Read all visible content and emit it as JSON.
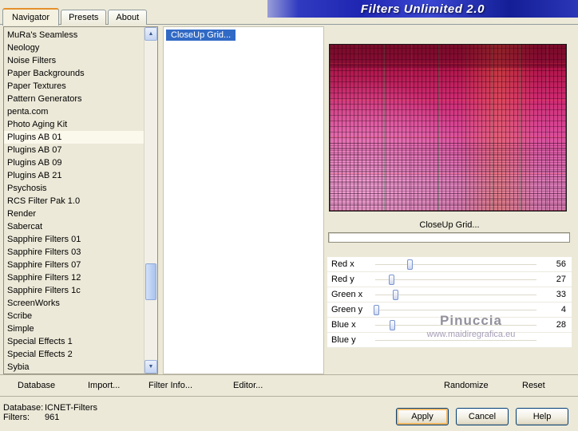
{
  "title": "Filters Unlimited 2.0",
  "tabs": [
    {
      "label": "Navigator"
    },
    {
      "label": "Presets"
    },
    {
      "label": "About"
    }
  ],
  "icons": {
    "scroll_up": "▲",
    "scroll_down": "▼"
  },
  "navigator": {
    "items": [
      "MuRa's Seamless",
      "Neology",
      "Noise Filters",
      "Paper Backgrounds",
      "Paper Textures",
      "Pattern Generators",
      "penta.com",
      "Photo Aging Kit",
      "Plugins AB 01",
      "Plugins AB 07",
      "Plugins AB 09",
      "Plugins AB 21",
      "Psychosis",
      "RCS Filter Pak 1.0",
      "Render",
      "Sabercat",
      "Sapphire Filters 01",
      "Sapphire Filters 03",
      "Sapphire Filters 07",
      "Sapphire Filters 12",
      "Sapphire Filters 1c",
      "ScreenWorks",
      "Scribe",
      "Simple",
      "Special Effects 1",
      "Special Effects 2",
      "Sybia"
    ],
    "selected": "Plugins AB 01"
  },
  "filters": {
    "items": [
      "CloseUp Grid..."
    ],
    "selected": "CloseUp Grid..."
  },
  "preview": {
    "caption": "CloseUp Grid...",
    "progress_percent": 0
  },
  "params": [
    {
      "label": "Red x",
      "value": 56
    },
    {
      "label": "Red y",
      "value": 27
    },
    {
      "label": "Green x",
      "value": 33
    },
    {
      "label": "Green y",
      "value": 4
    },
    {
      "label": "Blue x",
      "value": 28
    },
    {
      "label": "Blue y",
      "value": ""
    }
  ],
  "slider_max": 255,
  "watermark": {
    "line1": "Pinuccia",
    "line2": "www.maidiregrafica.eu"
  },
  "toolbar": {
    "database": "Database",
    "import": "Import...",
    "filter_info": "Filter Info...",
    "editor": "Editor...",
    "randomize": "Randomize",
    "reset": "Reset"
  },
  "status": {
    "database_label": "Database:",
    "database_value": "ICNET-Filters",
    "filters_label": "Filters:",
    "filters_value": "961"
  },
  "actions": {
    "apply": "Apply",
    "cancel": "Cancel",
    "help": "Help"
  },
  "colors": {
    "selection_blue": "#316ac5",
    "dialog_background": "#ece9d8",
    "tab_accent_orange": "#e5902a",
    "title_text": "#ffffff"
  }
}
